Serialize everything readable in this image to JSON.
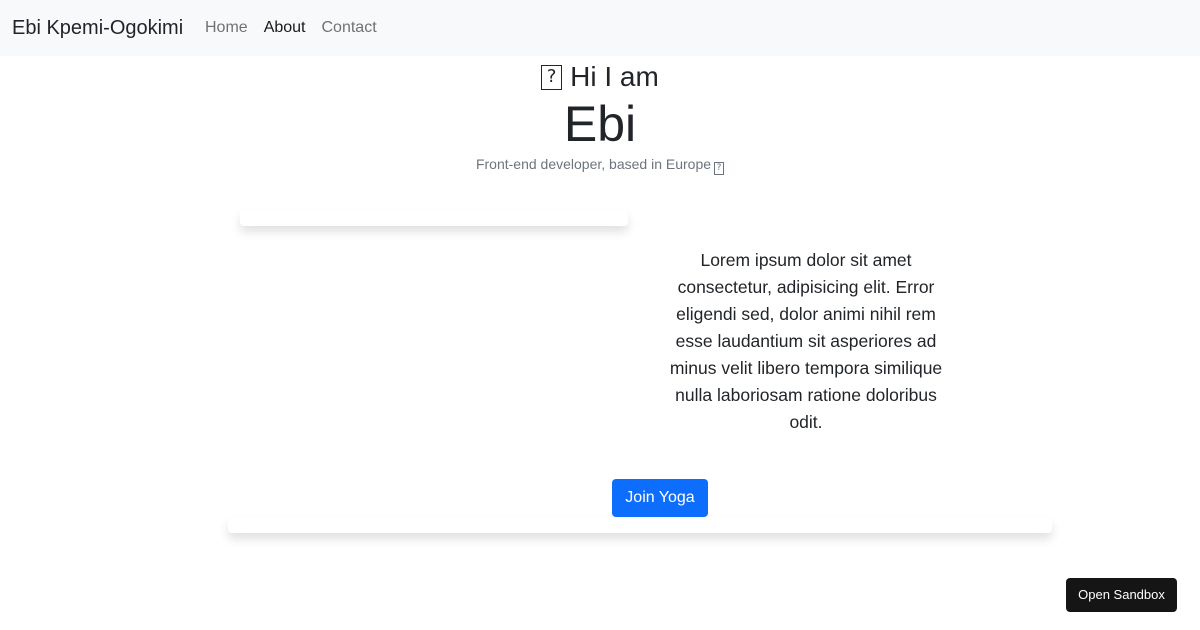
{
  "navbar": {
    "brand": "Ebi Kpemi-Ogokimi",
    "links": [
      {
        "label": "Home",
        "active": false
      },
      {
        "label": "About",
        "active": true
      },
      {
        "label": "Contact",
        "active": false
      }
    ]
  },
  "hero": {
    "greeting_emoji": "?",
    "greeting": "Hi I am",
    "name": "Ebi",
    "tagline": "Front-end developer, based in Europe",
    "tagline_emoji": "?"
  },
  "about": {
    "bio": "Lorem ipsum dolor sit amet consectetur, adipisicing elit. Error eligendi sed, dolor animi nihil rem esse laudantium sit asperiores ad minus velit libero tempora similique nulla laboriosam ratione doloribus odit.",
    "cta_label": "Join Yoga"
  },
  "sandbox_label": "Open Sandbox",
  "colors": {
    "navbar_bg": "#f8f9fa",
    "primary": "#0d6efd",
    "muted": "#6c757d",
    "sandbox_bg": "#151515"
  }
}
